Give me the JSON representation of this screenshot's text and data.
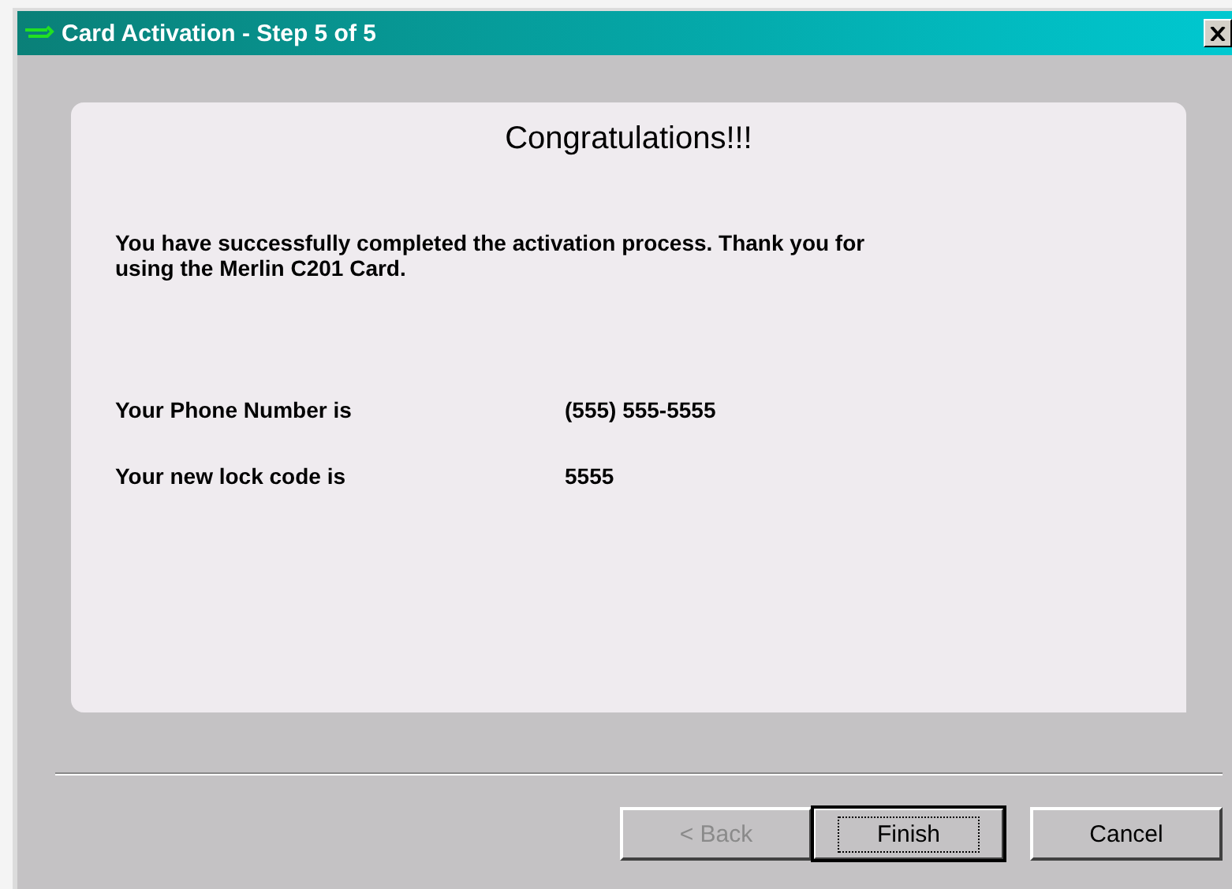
{
  "window": {
    "title": "Card Activation - Step 5 of 5"
  },
  "heading": "Congratulations!!!",
  "message": "You have successfully completed the activation process. Thank you for using the Merlin C201 Card.",
  "details": [
    {
      "label": "Your Phone Number is",
      "value": "(555) 555-5555"
    },
    {
      "label": "Your new lock code is",
      "value": "5555"
    }
  ],
  "buttons": [
    {
      "label": "< Back",
      "disabled": true,
      "default": false
    },
    {
      "label": "Finish",
      "disabled": false,
      "default": true
    },
    {
      "label": "Cancel",
      "disabled": false,
      "default": false
    }
  ]
}
